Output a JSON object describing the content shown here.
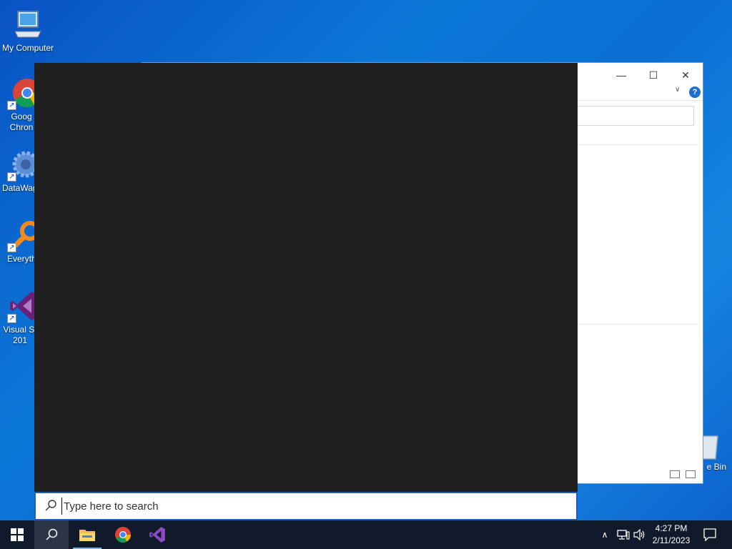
{
  "desktop": {
    "icons": [
      {
        "label": "My Computer",
        "icon": "computer-icon"
      },
      {
        "label": "Goog Chron",
        "icon": "chrome-icon"
      },
      {
        "label": "DataWag",
        "icon": "gear-icon"
      },
      {
        "label": "Everyth",
        "icon": "magnifier-icon"
      },
      {
        "label": "Visual St 201",
        "icon": "visual-studio-icon"
      }
    ],
    "recycle_bin_label": "e Bin"
  },
  "explorer": {
    "minimize_glyph": "—",
    "maximize_glyph": "☐",
    "close_glyph": "✕",
    "help_glyph": "?",
    "expand_glyph": "∨"
  },
  "search": {
    "placeholder": "Type here to search",
    "value": ""
  },
  "taskbar": {
    "buttons": [
      "start-button",
      "search-button",
      "file-explorer-button",
      "chrome-button",
      "visual-studio-button"
    ],
    "tray_chevron": "∧",
    "time": "4:27 PM",
    "date": "2/11/2023"
  },
  "colors": {
    "panel_bg": "#202020",
    "taskbar_bg": "#101a2b",
    "accent": "#1f5fb8"
  }
}
